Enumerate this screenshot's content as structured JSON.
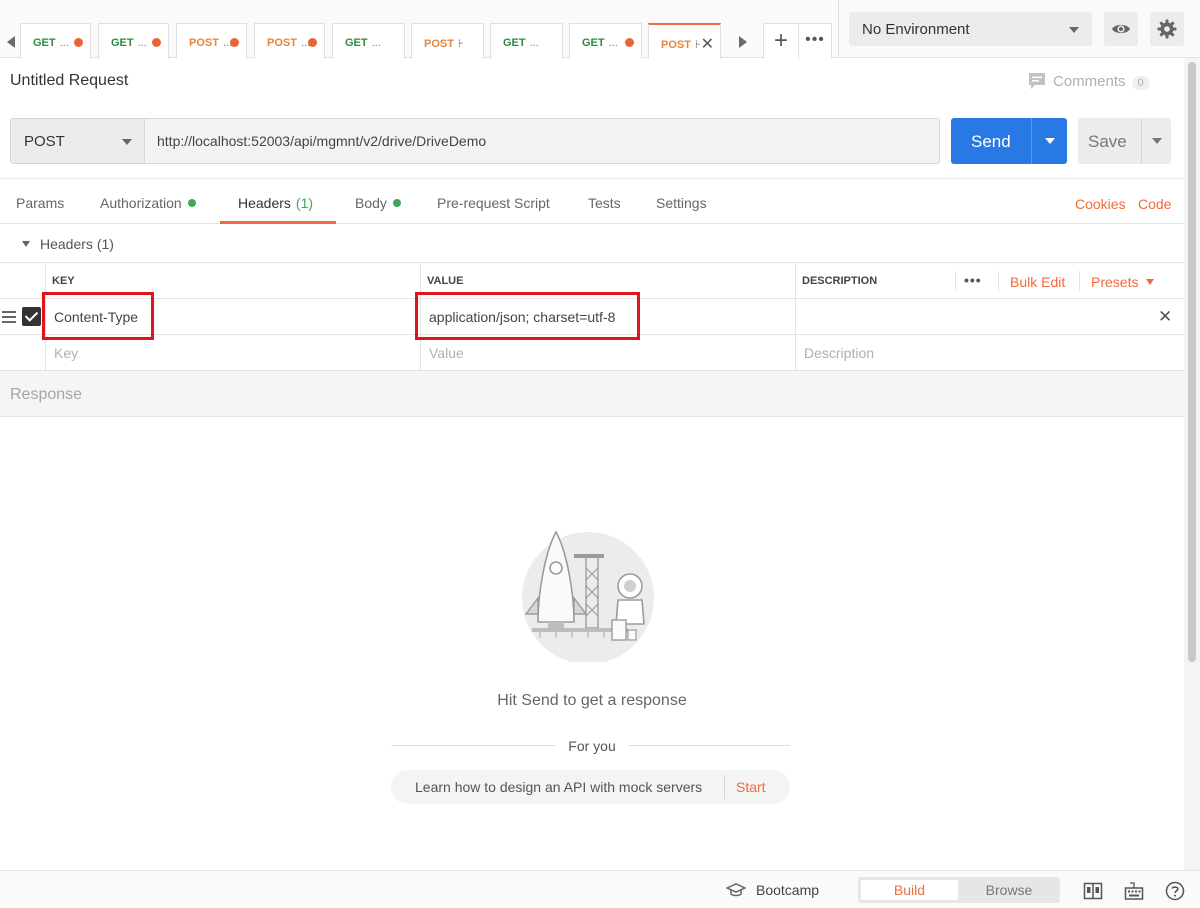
{
  "tabs": [
    {
      "method": "GET",
      "name": "...",
      "dot": true
    },
    {
      "method": "GET",
      "name": "...",
      "dot": true
    },
    {
      "method": "POST",
      "name": "...",
      "dot": true
    },
    {
      "method": "POST",
      "name": "...",
      "dot": true
    },
    {
      "method": "GET",
      "name": "...",
      "dot": false
    },
    {
      "method": "POST",
      "name": "⊦",
      "dot": false
    },
    {
      "method": "GET",
      "name": "...",
      "dot": false
    },
    {
      "method": "GET",
      "name": "...",
      "dot": true
    },
    {
      "method": "POST",
      "name": "⊦",
      "active": true
    }
  ],
  "tabs_more_label": "•••",
  "tabs_add_label": "+",
  "environment": {
    "selected": "No Environment"
  },
  "request": {
    "title": "Untitled Request",
    "comments_label": "Comments",
    "comments_count": "0",
    "method": "POST",
    "url": "http://localhost:52003/api/mgmnt/v2/drive/DriveDemo",
    "send_label": "Send",
    "save_label": "Save"
  },
  "request_tabs": {
    "params": "Params",
    "authorization": "Authorization",
    "headers": "Headers",
    "headers_count": "(1)",
    "body": "Body",
    "pre_request": "Pre-request Script",
    "tests": "Tests",
    "settings": "Settings",
    "cookies": "Cookies",
    "code": "Code"
  },
  "headers_section": {
    "title": "Headers",
    "count": "(1)",
    "columns": {
      "key": "KEY",
      "value": "VALUE",
      "description": "DESCRIPTION"
    },
    "more_label": "•••",
    "bulk_edit": "Bulk Edit",
    "presets": "Presets",
    "rows": [
      {
        "key": "Content-Type",
        "value": "application/json; charset=utf-8",
        "description": "",
        "enabled": true
      }
    ],
    "placeholders": {
      "key": "Key",
      "value": "Value",
      "description": "Description"
    }
  },
  "response": {
    "label": "Response",
    "empty_message": "Hit Send to get a response",
    "for_you": "For you",
    "learn_text": "Learn how to design an API with mock servers",
    "start_label": "Start"
  },
  "footer": {
    "bootcamp": "Bootcamp",
    "build": "Build",
    "browse": "Browse"
  },
  "colors": {
    "accent": "#f26b3a",
    "send_blue": "#2979e4",
    "get_green": "#2f8a43",
    "post_orange": "#e8843b",
    "highlight_red": "#e0141e"
  }
}
